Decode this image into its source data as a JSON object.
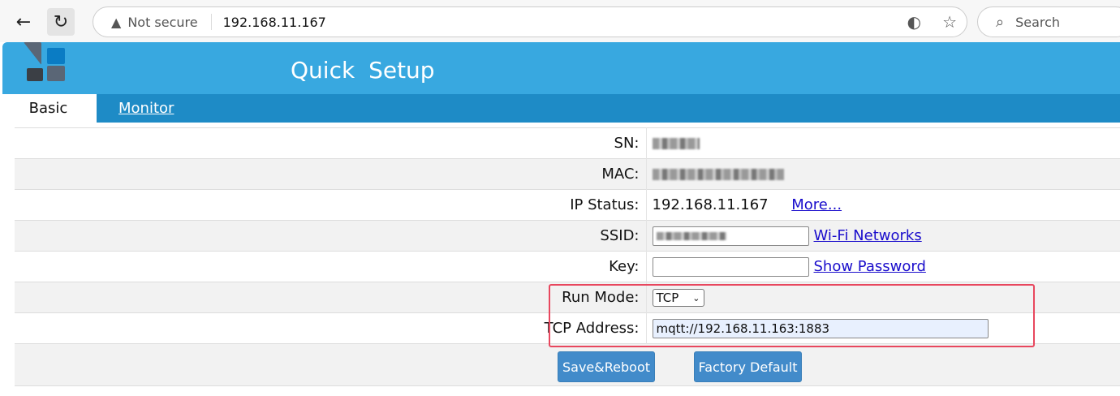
{
  "browser": {
    "not_secure": "Not secure",
    "url": "192.168.11.167",
    "search_placeholder": "Search"
  },
  "header": {
    "title": "Quick Setup"
  },
  "tabs": [
    {
      "label": "Basic"
    },
    {
      "label": "Monitor"
    }
  ],
  "form": {
    "sn_label": "SN:",
    "mac_label": "MAC:",
    "ip_label": "IP Status:",
    "ip_value": "192.168.11.167",
    "more_link": "More...",
    "ssid_label": "SSID:",
    "wifi_link": "Wi-Fi Networks",
    "key_label": "Key:",
    "key_value": "",
    "show_password": "Show Password",
    "run_mode_label": "Run Mode:",
    "run_mode_value": "TCP",
    "tcp_address_label": "TCP Address:",
    "tcp_address_value": "mqtt://192.168.11.163:1883"
  },
  "buttons": {
    "save": "Save&Reboot",
    "factory": "Factory Default"
  }
}
